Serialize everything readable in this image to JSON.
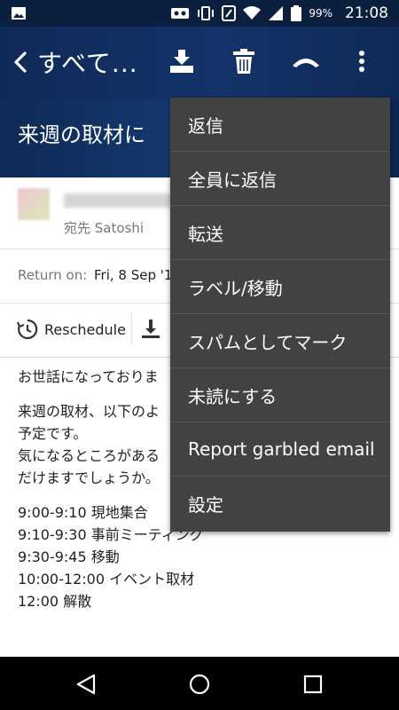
{
  "status_bar": {
    "battery": "99%",
    "time": "21:08"
  },
  "toolbar": {
    "title": "すべて..."
  },
  "email": {
    "subject": "来週の取材に",
    "to": "宛先 Satoshi",
    "return_label": "Return on:",
    "return_value": "Fri, 8 Sep '1",
    "reschedule": "Reschedule",
    "body_paragraphs": [
      [
        "お世話になっておりま"
      ],
      [
        "来週の取材、以下のよ",
        "予定です。",
        "気になるところがある",
        "だけますでしょうか。"
      ],
      [
        "9:00-9:10 現地集合",
        "9:10-9:30 事前ミーティング",
        "9:30-9:45 移動",
        "10:00-12:00 イベント取材",
        "12:00 解散"
      ]
    ]
  },
  "menu": {
    "items": [
      "返信",
      "全員に返信",
      "転送",
      "ラベル/移動",
      "スパムとしてマーク",
      "未読にする",
      "Report garbled email",
      "設定"
    ]
  },
  "colors": {
    "toolbar_bg": "#13336a",
    "menu_bg": "#424242"
  }
}
